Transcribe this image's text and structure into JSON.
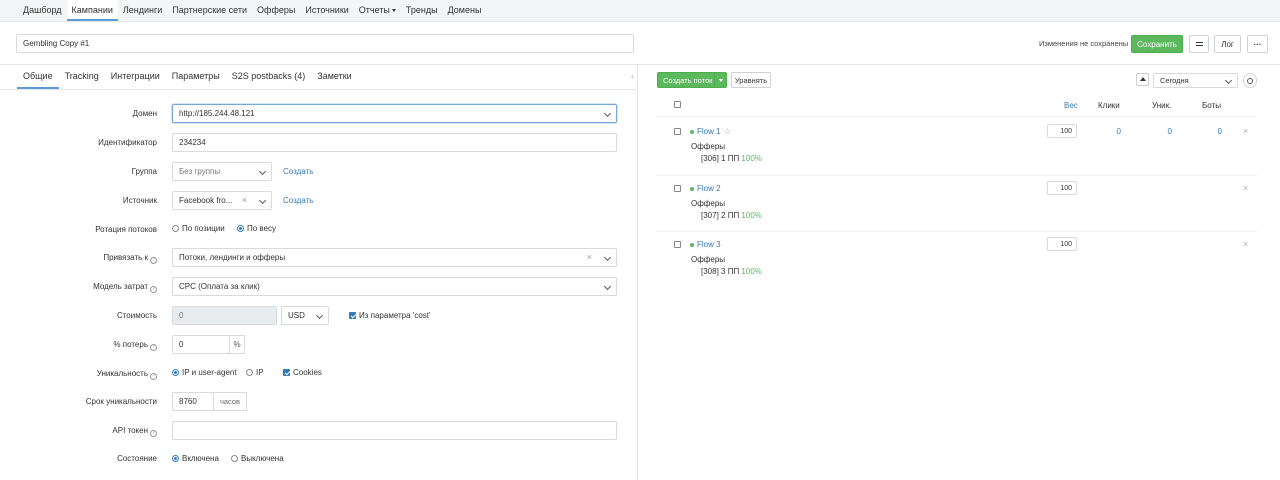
{
  "nav": [
    "Дашборд",
    "Кампании",
    "Лендинги",
    "Партнерские сети",
    "Офферы",
    "Источники",
    "Отчеты",
    "Тренды",
    "Домены"
  ],
  "campaign_name": "Gembling Copy #1",
  "header": {
    "unsaved": "Изменения не сохранены",
    "save": "Сохранить",
    "log": "Лог",
    "more": "···"
  },
  "tabs": [
    "Общие",
    "Tracking",
    "Интеграции",
    "Параметры",
    "S2S postbacks (4)",
    "Заметки"
  ],
  "form": {
    "domain_label": "Домен",
    "domain_value": "http://185.244.48.121",
    "id_label": "Идентификатор",
    "id_value": "234234",
    "group_label": "Группа",
    "group_value": "Без группы",
    "create_link": "Создать",
    "source_label": "Источник",
    "source_value": "Facebook fro...",
    "rotation_label": "Ротация потоков",
    "rotation_opt1": "По позиции",
    "rotation_opt2": "По весу",
    "bind_label": "Привязать к",
    "bind_value": "Потоки, лендинги и офферы",
    "cost_model_label": "Модель затрат",
    "cost_model_value": "CPC (Оплата за клик)",
    "cost_label": "Стоимость",
    "cost_value": "0",
    "currency": "USD",
    "from_param": "Из параметра 'cost'",
    "loss_label": "% потерь",
    "loss_value": "0",
    "percent": "%",
    "unique_label": "Уникальность",
    "unique_opt1": "IP и user-agent",
    "unique_opt2": "IP",
    "unique_opt3": "Cookies",
    "term_label": "Срок уникальности",
    "term_value": "8760",
    "hours": "часов",
    "api_label": "API токен",
    "state_label": "Состояние",
    "state_on": "Включена",
    "state_off": "Выключена",
    "help": "?"
  },
  "right": {
    "create_flow": "Создать поток",
    "equalize": "Уравнять",
    "period": "Сегодня",
    "col_weight": "Вес",
    "col_clicks": "Клики",
    "col_unique": "Уник.",
    "col_bots": "Боты",
    "offers_label": "Офферы",
    "flows": [
      {
        "name": "Flow 1",
        "offer": "[306] 1 ПП",
        "pct": "100%",
        "weight": "100",
        "clicks": "0",
        "unique": "0",
        "bots": "0"
      },
      {
        "name": "Flow 2",
        "offer": "[307] 2 ПП",
        "pct": "100%",
        "weight": "100"
      },
      {
        "name": "Flow 3",
        "offer": "[308] 3 ПП",
        "pct": "100%",
        "weight": "100"
      }
    ]
  }
}
